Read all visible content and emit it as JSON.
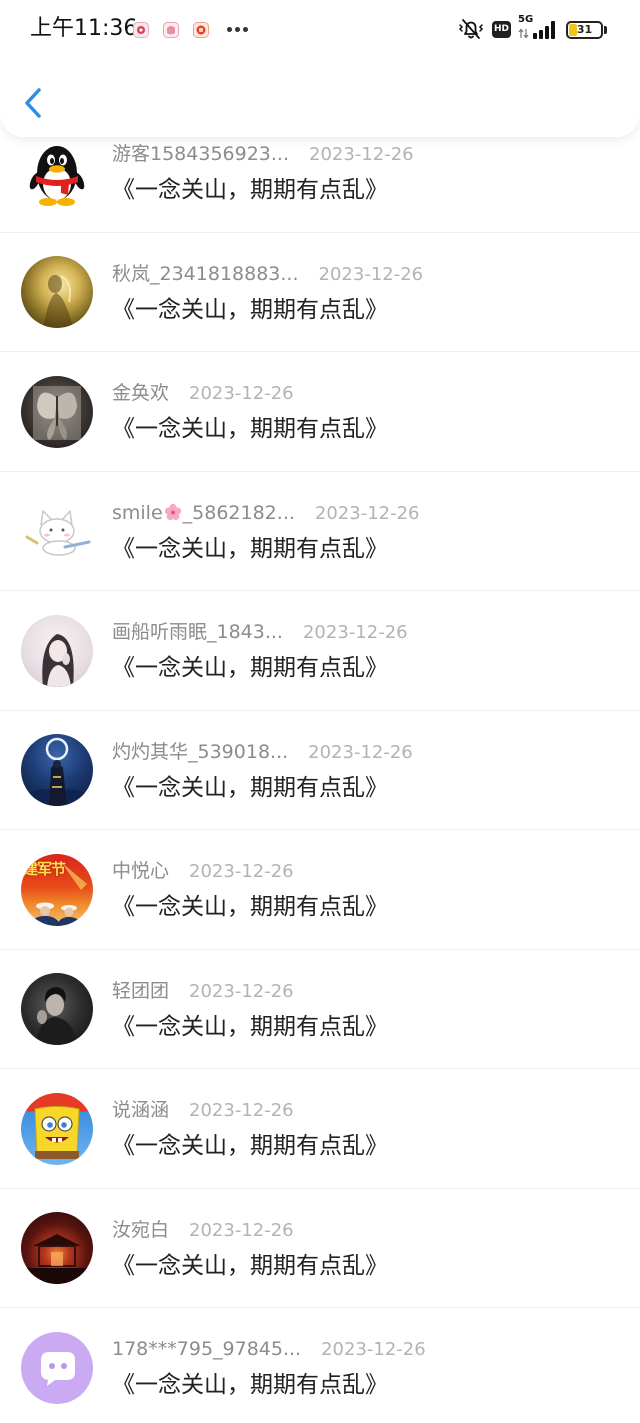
{
  "status_bar": {
    "time": "上午11:36",
    "hd_label": "HD",
    "network_label": "5G",
    "battery_text": "31",
    "battery_level": 0.31,
    "icons": [
      "app-notification-icon",
      "app-notification-icon",
      "app-notification-icon",
      "more-notifications-icon",
      "vibrate-off-icon",
      "data-transfer-icon",
      "signal-icon",
      "battery-icon"
    ]
  },
  "header": {
    "back_icon": "chevron-left-icon"
  },
  "theme": {
    "accent": "#2b8ee6",
    "name_color": "#8c8c8c",
    "date_color": "#b3b3b3",
    "title_color": "#222222",
    "battery_fill": "#f2c318"
  },
  "list": {
    "rows": [
      {
        "avatar": "qq-penguin",
        "name": "游客1584356923...",
        "date": "2023-12-26",
        "title": "《一念关山，期期有点乱》"
      },
      {
        "avatar": "golden-figure-photo",
        "name": "秋岚_2341818883...",
        "date": "2023-12-26",
        "title": "《一念关山，期期有点乱》"
      },
      {
        "avatar": "butterfly-photo",
        "name": "金奂欢",
        "date": "2023-12-26",
        "title": "《一念关山，期期有点乱》"
      },
      {
        "avatar": "white-cat-cartoon",
        "name": "smile🌸_5862182...",
        "date": "2023-12-26",
        "title": "《一念关山，期期有点乱》"
      },
      {
        "avatar": "girl-portrait-photo",
        "name": "画船听雨眠_1843...",
        "date": "2023-12-26",
        "title": "《一念关山，期期有点乱》"
      },
      {
        "avatar": "moonlit-night-art",
        "name": "灼灼其华_539018...",
        "date": "2023-12-26",
        "title": "《一念关山，期期有点乱》"
      },
      {
        "avatar": "army-day-poster",
        "avatar_text": "建军节",
        "name": "中悦心",
        "date": "2023-12-26",
        "title": "《一念关山，期期有点乱》"
      },
      {
        "avatar": "dark-portrait-photo",
        "name": "轻团团",
        "date": "2023-12-26",
        "title": "《一念关山，期期有点乱》"
      },
      {
        "avatar": "spongebob-cartoon",
        "name": "说涵涵",
        "date": "2023-12-26",
        "title": "《一念关山，期期有点乱》"
      },
      {
        "avatar": "night-temple-photo",
        "name": "汝宛白",
        "date": "2023-12-26",
        "title": "《一念关山，期期有点乱》"
      },
      {
        "avatar": "default-chat-bubble",
        "name": "178***795_97845...",
        "date": "2023-12-26",
        "title": "《一念关山，期期有点乱》"
      }
    ]
  }
}
